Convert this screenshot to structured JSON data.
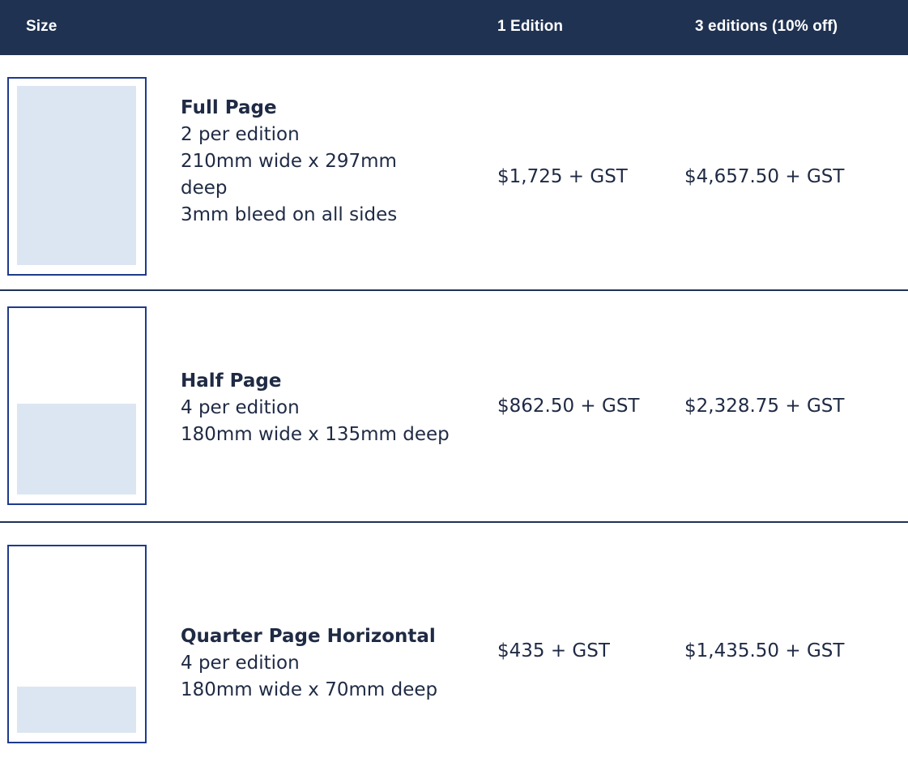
{
  "header": {
    "size_label": "Size",
    "one_edition_label": "1 Edition",
    "three_editions_label": "3 editions (10% off)"
  },
  "rows": [
    {
      "title": "Full Page",
      "lines": [
        "2 per edition",
        "210mm wide x 297mm",
        "deep",
        "3mm bleed on all sides"
      ],
      "price_one": "$1,725 + GST",
      "price_three": "$4,657.50 + GST",
      "fill_fraction": 1.0
    },
    {
      "title": "Half Page",
      "lines": [
        "4 per edition",
        "180mm wide x 135mm deep"
      ],
      "price_one": "$862.50 + GST",
      "price_three": "$2,328.75 + GST",
      "fill_fraction": 0.5
    },
    {
      "title": "Quarter Page Horizontal",
      "lines": [
        "4 per edition",
        "180mm wide x 70mm deep"
      ],
      "price_one": "$435 + GST",
      "price_three": "$1,435.50 + GST",
      "fill_fraction": 0.25
    }
  ],
  "colors": {
    "header_bg": "#1f3252",
    "thumb_border": "#1f3a8c",
    "thumb_fill": "#dce6f2",
    "text": "#1f2a44"
  }
}
